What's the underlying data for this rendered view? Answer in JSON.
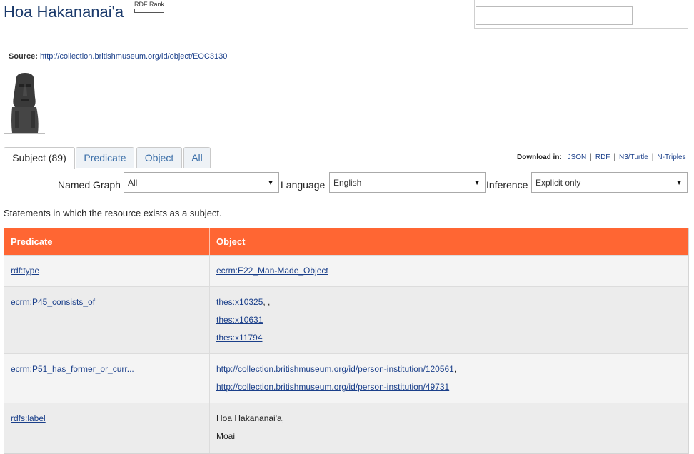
{
  "header": {
    "title": "Hoa Hakananai'a",
    "rank_label": "RDF Rank",
    "search_value": ""
  },
  "source": {
    "label": "Source:",
    "url": "http://collection.britishmuseum.org/id/object/EOC3130"
  },
  "tabs": [
    {
      "label": "Subject (89)",
      "active": true
    },
    {
      "label": "Predicate",
      "active": false
    },
    {
      "label": "Object",
      "active": false
    },
    {
      "label": "All",
      "active": false
    }
  ],
  "download": {
    "label": "Download in:",
    "formats": [
      "JSON",
      "RDF",
      "N3/Turtle",
      "N-Triples"
    ]
  },
  "filters": {
    "named_graph_label": "Named Graph",
    "named_graph_value": "All",
    "language_label": "Language",
    "language_value": "English",
    "inference_label": "Inference",
    "inference_value": "Explicit only"
  },
  "statements_text": "Statements in which the resource exists as a subject.",
  "table": {
    "headers": [
      "Predicate",
      "Object"
    ],
    "rows": [
      {
        "predicate": "rdf:type",
        "objects": [
          "ecrm:E22_Man-Made_Object"
        ]
      },
      {
        "predicate": "ecrm:P45_consists_of",
        "objects": [
          "thes:x10325",
          "thes:x10631",
          "thes:x11794"
        ]
      },
      {
        "predicate": "ecrm:P51_has_former_or_curr...",
        "objects": [
          "http://collection.britishmuseum.org/id/person-institution/120561",
          "http://collection.britishmuseum.org/id/person-institution/49731"
        ]
      },
      {
        "predicate": "rdfs:label",
        "objects": [
          "Hoa Hakananai'a",
          "Moai"
        ]
      }
    ]
  },
  "icons": {
    "dropdown": "chevron-down-icon",
    "thumbnail": "moai-statue-image"
  }
}
